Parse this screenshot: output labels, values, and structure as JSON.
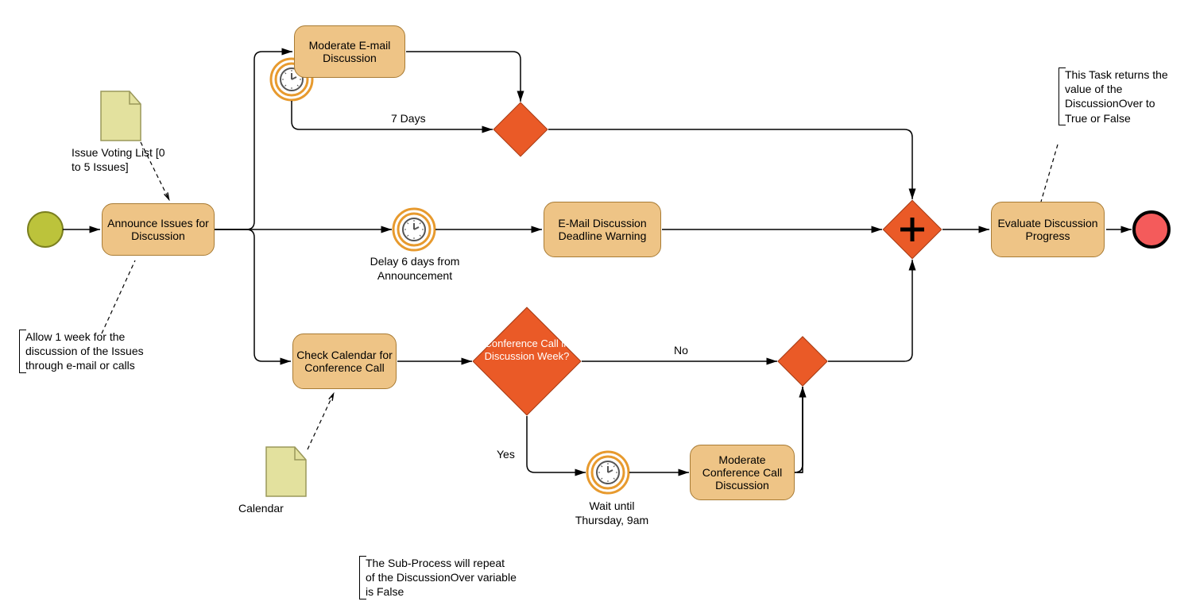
{
  "tasks": {
    "announce": "Announce Issues for Discussion",
    "moderate_email": "Moderate E-mail Discussion",
    "deadline_warning": "E-Mail Discussion Deadline Warning",
    "check_calendar": "Check Calendar for Conference Call",
    "moderate_conf": "Moderate Conference Call Discussion",
    "evaluate": "Evaluate Discussion Progress"
  },
  "gateway": {
    "conf_week": "Conference Call in Discussion Week?"
  },
  "timers": {
    "seven_days": "7 Days",
    "delay6": "Delay 6 days from Announcement",
    "wait_thurs": "Wait until Thursday, 9am"
  },
  "flows": {
    "no": "No",
    "yes": "Yes"
  },
  "docs": {
    "voting_list": "Issue Voting List [0 to 5 Issues]",
    "calendar": "Calendar"
  },
  "annotations": {
    "allow_week": "Allow 1 week for the discussion of the Issues through e-mail or calls",
    "subprocess": "The Sub-Process will repeat of the DiscussionOver variable is False",
    "task_returns": "This Task returns the value of the DiscussionOver to True or False"
  }
}
